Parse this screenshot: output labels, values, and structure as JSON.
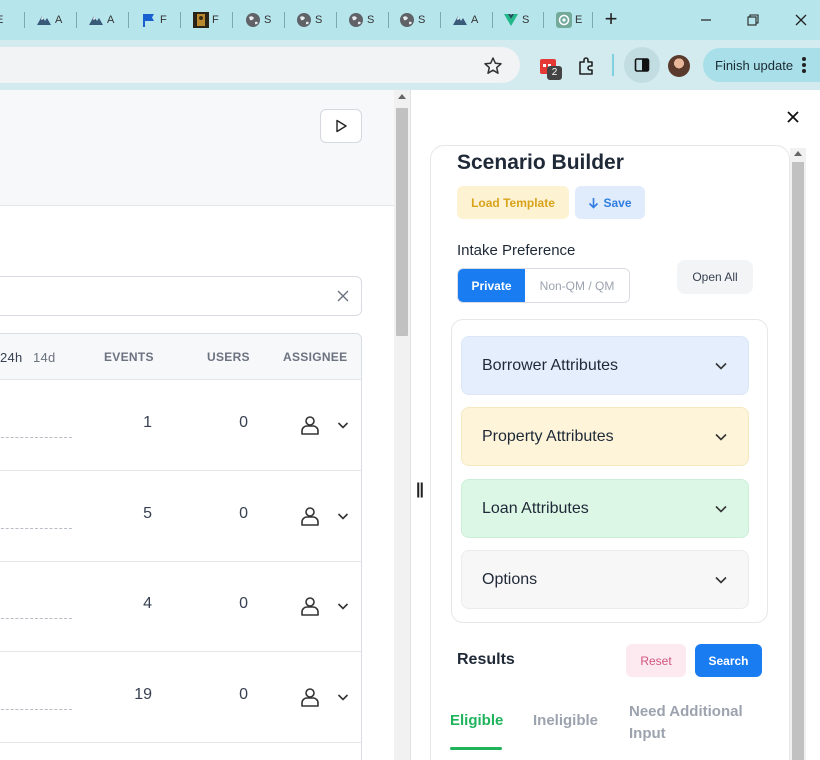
{
  "browser": {
    "tabs": [
      {
        "icon": "page-icon",
        "label": "E"
      },
      {
        "icon": "mountain-icon",
        "label": "A"
      },
      {
        "icon": "mountain-icon",
        "label": "A"
      },
      {
        "icon": "flag-icon",
        "label": "F"
      },
      {
        "icon": "portrait-icon",
        "label": "F"
      },
      {
        "icon": "globe-icon",
        "label": "S"
      },
      {
        "icon": "globe-icon",
        "label": "S"
      },
      {
        "icon": "globe-icon",
        "label": "S"
      },
      {
        "icon": "globe-icon",
        "label": "S"
      },
      {
        "icon": "mountain-icon",
        "label": "A"
      },
      {
        "icon": "vue-icon",
        "label": "S"
      },
      {
        "icon": "openai-icon",
        "label": "E"
      }
    ],
    "new_tab_label": "+",
    "extension_badge": "2",
    "finish_update_label": "Finish update",
    "accent_color": "#b6e5ec"
  },
  "left_table": {
    "headers": {
      "period_24h": "24h",
      "period_14d": "14d",
      "events": "EVENTS",
      "users": "USERS",
      "assignee": "ASSIGNEE"
    },
    "rows": [
      {
        "events": "1",
        "users": "0"
      },
      {
        "events": "5",
        "users": "0"
      },
      {
        "events": "4",
        "users": "0"
      },
      {
        "events": "19",
        "users": "0"
      }
    ]
  },
  "panel": {
    "close_label": "✕",
    "title": "Scenario Builder",
    "load_template_label": "Load Template",
    "save_label": "Save",
    "intake_preference_label": "Intake Preference",
    "intake_options": [
      "Private",
      "Non-QM / QM"
    ],
    "intake_selected": "Private",
    "open_all_label": "Open All",
    "sections": [
      {
        "label": "Borrower Attributes",
        "color": "#e4eefc"
      },
      {
        "label": "Property Attributes",
        "color": "#fdf4d9"
      },
      {
        "label": "Loan Attributes",
        "color": "#ddf7e6"
      },
      {
        "label": "Options",
        "color": "#f7f7f8"
      }
    ],
    "results_label": "Results",
    "reset_label": "Reset",
    "search_label": "Search",
    "result_tabs": [
      "Eligible",
      "Ineligible",
      "Need Additional Input"
    ],
    "result_tab_selected": "Eligible"
  }
}
